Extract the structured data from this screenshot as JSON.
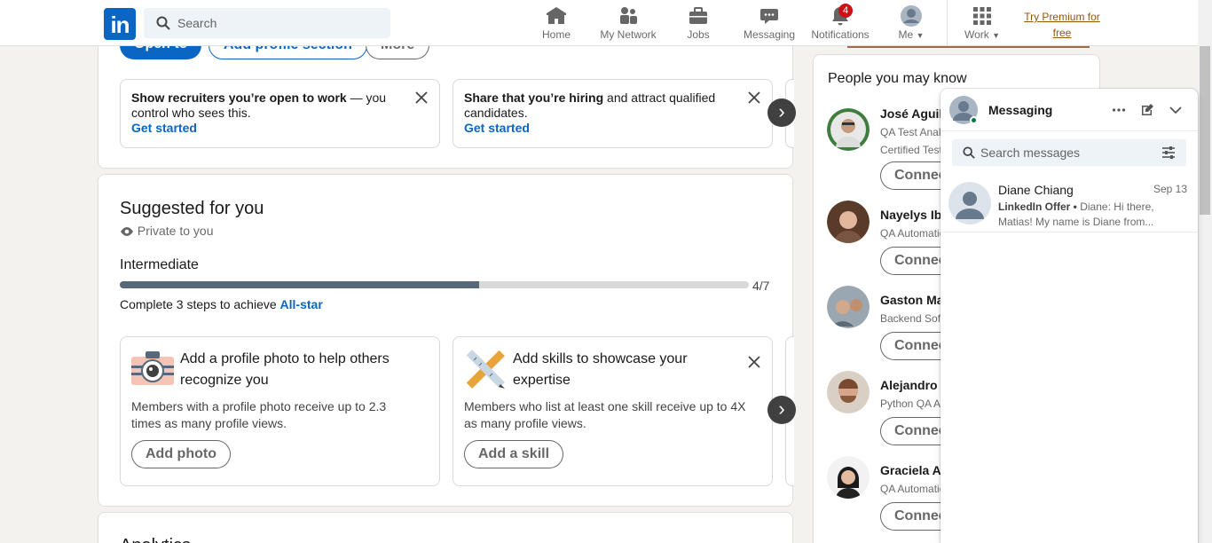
{
  "nav": {
    "search_placeholder": "Search",
    "items": [
      {
        "label": "Home",
        "icon": "home-icon"
      },
      {
        "label": "My Network",
        "icon": "network-icon"
      },
      {
        "label": "Jobs",
        "icon": "jobs-icon"
      },
      {
        "label": "Messaging",
        "icon": "messaging-icon"
      },
      {
        "label": "Notifications",
        "icon": "bell-icon",
        "badge": "4"
      },
      {
        "label": "Me",
        "icon": "avatar"
      },
      {
        "label": "Work",
        "icon": "grid-icon"
      }
    ],
    "premium_line1": "Try Premium for",
    "premium_line2": "free",
    "premium_color": "#915907",
    "brand_color": "#0a66c2",
    "logo": "in"
  },
  "top_card": {
    "open_to": "Open to",
    "add_section": "Add profile section",
    "more": "More",
    "cards": [
      {
        "bold": "Show recruiters you’re open to work",
        "rest": " — you control who sees this.",
        "link": "Get started"
      },
      {
        "bold": "Share that you’re hiring",
        "rest": " and attract qualified candidates.",
        "link": "Get started"
      }
    ]
  },
  "suggested": {
    "title": "Suggested for you",
    "privacy": "Private to you",
    "level": "Intermediate",
    "progress_text": "4/7",
    "progress_value": 0.5714,
    "steps_text": "Complete 3 steps to achieve ",
    "steps_link": "All-star",
    "cards": [
      {
        "title": "Add a profile photo to help others recognize you",
        "desc": "Members with a profile photo receive up to 2.3 times as many profile views.",
        "button": "Add photo"
      },
      {
        "title": "Add skills to showcase your expertise",
        "desc": "Members who list at least one skill receive up to 4X as many profile views.",
        "button": "Add a skill"
      }
    ]
  },
  "analytics_title": "Analytics",
  "pymk": {
    "title": "People you may know",
    "connect": "Connect",
    "people": [
      {
        "name": "José Aguilar",
        "title": "QA Test Analyst",
        "title2": "Certified Tester"
      },
      {
        "name": "Nayelys Ibarra",
        "title": "QA Automation"
      },
      {
        "name": "Gaston Martinez",
        "title": "Backend Software"
      },
      {
        "name": "Alejandro Perez",
        "title": "Python QA Automation"
      },
      {
        "name": "Graciela Arias",
        "title": "QA Automation"
      }
    ]
  },
  "messaging": {
    "title": "Messaging",
    "search_placeholder": "Search messages",
    "conversations": [
      {
        "name": "Diane Chiang",
        "date": "Sep 13",
        "tag": "LinkedIn Offer •",
        "preview1": "Diane: Hi there,",
        "preview2": "Matias! My name is Diane from..."
      }
    ]
  }
}
